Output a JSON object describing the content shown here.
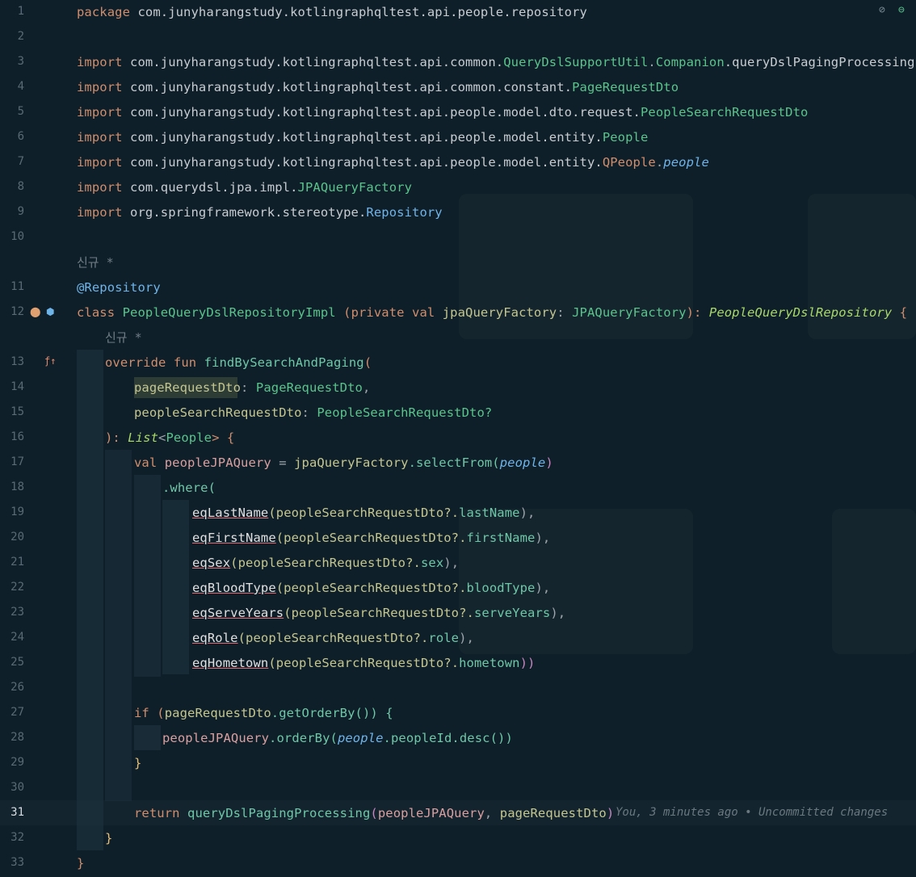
{
  "editor": {
    "top_icons": [
      "eye-slash-icon",
      "minus-circle-icon"
    ],
    "inlay_label_1": "신규 *",
    "inlay_label_2": "신규 *",
    "blame_hint": "You, 3 minutes ago • Uncommitted changes",
    "line_numbers": [
      "1",
      "2",
      "3",
      "4",
      "5",
      "6",
      "7",
      "8",
      "9",
      "10",
      "11",
      "12",
      "13",
      "14",
      "15",
      "16",
      "17",
      "18",
      "19",
      "20",
      "21",
      "22",
      "23",
      "24",
      "25",
      "26",
      "27",
      "28",
      "29",
      "30",
      "31",
      "32",
      "33"
    ],
    "current_line": "31",
    "lines": {
      "l1a": "package ",
      "l1b": "com.junyharangstudy.kotlingraphqltest.api.people.repository",
      "l3a": "import ",
      "l3b": "com.junyharangstudy.kotlingraphqltest.api.common.",
      "l3c": "QueryDslSupportUtil",
      "l3d": ".",
      "l3e": "Companion",
      "l3f": ".queryDslPagingProcessing",
      "l4a": "import ",
      "l4b": "com.junyharangstudy.kotlingraphqltest.api.common.constant.",
      "l4c": "PageRequestDto",
      "l5a": "import ",
      "l5b": "com.junyharangstudy.kotlingraphqltest.api.people.model.dto.request.",
      "l5c": "PeopleSearchRequestDto",
      "l6a": "import ",
      "l6b": "com.junyharangstudy.kotlingraphqltest.api.people.model.entity.",
      "l6c": "People",
      "l7a": "import ",
      "l7b": "com.junyharangstudy.kotlingraphqltest.api.people.model.entity.",
      "l7c": "QPeople",
      "l7d": ".",
      "l7e": "people",
      "l8a": "import ",
      "l8b": "com.querydsl.jpa.impl.",
      "l8c": "JPAQueryFactory",
      "l9a": "import ",
      "l9b": "org.springframework.stereotype.",
      "l9c": "Repository",
      "l11": "@Repository",
      "l12a": "class ",
      "l12b": "PeopleQueryDslRepositoryImpl ",
      "l12c": "(",
      "l12d": "private val ",
      "l12e": "jpaQueryFactory",
      "l12f": ": ",
      "l12g": "JPAQueryFactory",
      "l12h": "): ",
      "l12i": "PeopleQueryDslRepository",
      "l12j": " {",
      "l13a": "override fun ",
      "l13b": "findBySearchAndPaging",
      "l13c": "(",
      "l14a": "pageRequestDto",
      "l14b": ": ",
      "l14c": "PageRequestDto",
      "l14d": ",",
      "l15a": "peopleSearchRequestDto",
      "l15b": ": ",
      "l15c": "PeopleSearchRequestDto?",
      "l16a": "): ",
      "l16b": "List",
      "l16c": "<",
      "l16d": "People",
      "l16e": "> {",
      "l17a": "val ",
      "l17b": "peopleJPAQuery",
      "l17c": " = ",
      "l17d": "jpaQueryFactory",
      "l17e": ".selectFrom(",
      "l17f": "people",
      "l17g": ")",
      "l18": ".where(",
      "l19a": "eqLastName",
      "l19b": "(peopleSearchRequestDto?.",
      "l19c": "lastName",
      "l19d": "),",
      "l20a": "eqFirstName",
      "l20b": "(peopleSearchRequestDto?.",
      "l20c": "firstName",
      "l20d": "),",
      "l21a": "eqSex",
      "l21b": "(peopleSearchRequestDto?.",
      "l21c": "sex",
      "l21d": "),",
      "l22a": "eqBloodType",
      "l22b": "(peopleSearchRequestDto?.",
      "l22c": "bloodType",
      "l22d": "),",
      "l23a": "eqServeYears",
      "l23b": "(peopleSearchRequestDto?.",
      "l23c": "serveYears",
      "l23d": "),",
      "l24a": "eqRole",
      "l24b": "(peopleSearchRequestDto?.",
      "l24c": "role",
      "l24d": "),",
      "l25a": "eqHometown",
      "l25b": "(peopleSearchRequestDto?.",
      "l25c": "hometown",
      "l25d": "))",
      "l27a": "if ",
      "l27b": "(",
      "l27c": "pageRequestDto",
      "l27d": ".getOrderBy()) {",
      "l28a": "peopleJPAQuery",
      "l28b": ".orderBy(",
      "l28c": "people",
      "l28d": ".peopleId.desc())",
      "l29": "}",
      "l31a": "return ",
      "l31b": "queryDslPagingProcessing",
      "l31c": "(",
      "l31d": "peopleJPAQuery",
      "l31e": ", ",
      "l31f": "pageRequestDto",
      "l31g": ")",
      "l32": "}",
      "l33": "}"
    }
  }
}
